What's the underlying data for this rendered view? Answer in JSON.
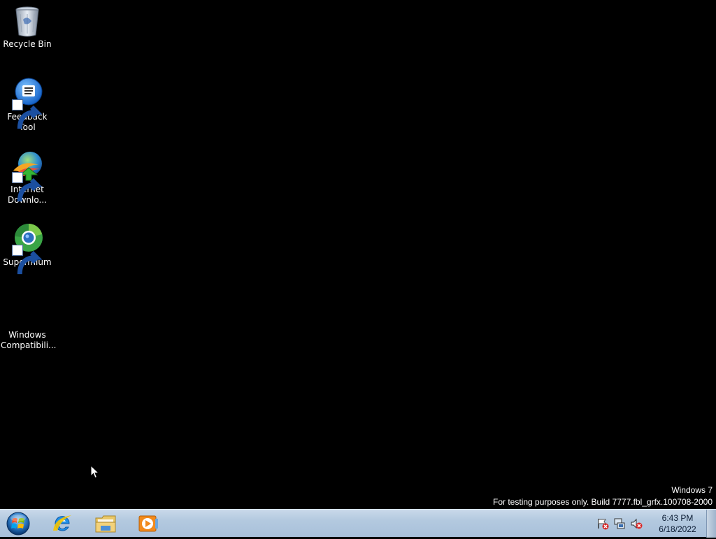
{
  "desktop": {
    "icons": [
      {
        "label": "Recycle Bin",
        "icon": "recycle-bin-icon"
      },
      {
        "label": "Feedback\nTool",
        "icon": "feedback-tool-icon"
      },
      {
        "label": "Internet\nDownlo...",
        "icon": "internet-download-manager-icon"
      },
      {
        "label": "Supermium",
        "icon": "supermium-browser-icon"
      },
      {
        "label": "Windows\nCompatibili...",
        "icon": "blank-icon"
      }
    ],
    "watermark": {
      "line1": "Windows 7",
      "line2": "For testing purposes only. Build 7777.fbl_grfx.100708-2000"
    }
  },
  "taskbar": {
    "start_button": "start-orb-icon",
    "pinned": [
      {
        "name": "internet-explorer",
        "icon": "internet-explorer-icon"
      },
      {
        "name": "windows-explorer",
        "icon": "folder-icon"
      },
      {
        "name": "windows-media-player",
        "icon": "media-player-icon"
      }
    ],
    "tray": {
      "icons": [
        "action-center-flag-icon",
        "network-icon",
        "volume-muted-icon"
      ],
      "time": "6:43 PM",
      "date": "6/18/2022"
    }
  },
  "colors": {
    "desktop_bg": "#000000",
    "taskbar_bg": "#b3c9df",
    "text": "#ffffff"
  }
}
